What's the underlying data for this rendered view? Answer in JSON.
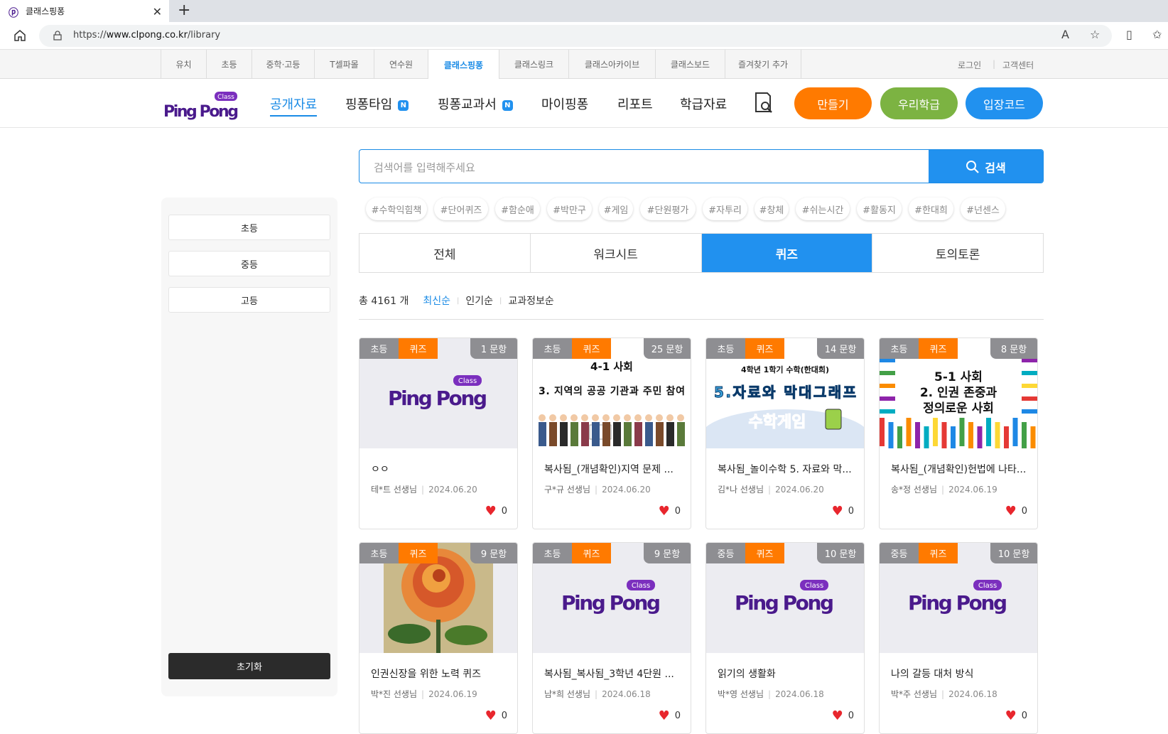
{
  "browser": {
    "tab_title": "클래스핑퐁",
    "url_prefix": "https://",
    "url_host": "www.clpong.co.kr",
    "url_path": "/library"
  },
  "service_nav": {
    "items": [
      "유치",
      "초등",
      "중학·고등",
      "T셀파몰",
      "연수원",
      "클래스핑퐁",
      "클래스링크",
      "클래스아카이브",
      "클래스보드",
      "즐겨찾기 추가"
    ],
    "active": "클래스핑퐁",
    "login": "로그인",
    "support": "고객센터"
  },
  "gnb": {
    "logo_text": "Ping Pong",
    "logo_badge": "Class",
    "menu": [
      "공개자료",
      "핑퐁타임",
      "핑퐁교과서",
      "마이핑퐁",
      "리포트",
      "학급자료"
    ],
    "new_badge": "N",
    "make": "만들기",
    "our_class": "우리학급",
    "entry_code": "입장코드",
    "colors": {
      "make": "#ff7a00",
      "our_class": "#7cb342",
      "entry_code": "#2191ef"
    }
  },
  "sidebar": {
    "levels": [
      "초등",
      "중등",
      "고등"
    ],
    "reset": "초기화"
  },
  "search": {
    "placeholder": "검색어를 입력해주세요",
    "button": "검색"
  },
  "tags": [
    "#수학익힘책",
    "#단어퀴즈",
    "#함순애",
    "#박만구",
    "#게임",
    "#단원평가",
    "#자투리",
    "#창체",
    "#쉬는시간",
    "#활동지",
    "#한대희",
    "#넌센스"
  ],
  "content_tabs": [
    "전체",
    "워크시트",
    "퀴즈",
    "토의토론"
  ],
  "active_tab": "퀴즈",
  "sort": {
    "total_prefix": "총",
    "total_count": "4161",
    "total_suffix": "개",
    "options": [
      "최신순",
      "인기순",
      "교과정보순"
    ]
  },
  "cards": [
    {
      "level": "초등",
      "type": "퀴즈",
      "count": "1 문항",
      "title": "ㅇㅇ",
      "author": "테*트 선생님",
      "date": "2024.06.20",
      "likes": "0",
      "thumb": "logo"
    },
    {
      "level": "초등",
      "type": "퀴즈",
      "count": "25 문항",
      "title": "복사됨_(개념확인)지역 문제 ...",
      "author": "구*규 선생님",
      "date": "2024.06.20",
      "likes": "0",
      "thumb": "social41",
      "thumb_line1": "4-1 사회",
      "thumb_line2": "3. 지역의 공공 기관과 주민 참여"
    },
    {
      "level": "초등",
      "type": "퀴즈",
      "count": "14 문항",
      "title": "복사됨_놀이수학 5. 자료와 막...",
      "author": "김*나 선생님",
      "date": "2024.06.20",
      "likes": "0",
      "thumb": "math",
      "thumb_line1": "4학년 1학기 수학(한대희)",
      "thumb_line2": "5.자료와 막대그래프",
      "thumb_line3": "수학게임"
    },
    {
      "level": "초등",
      "type": "퀴즈",
      "count": "8 문항",
      "title": "복사됨_(개념확인)헌법에 나타...",
      "author": "송*정 선생님",
      "date": "2024.06.19",
      "likes": "0",
      "thumb": "social51",
      "thumb_line1": "5-1 사회",
      "thumb_line2": "2. 인권 존중과",
      "thumb_line3": "정의로운 사회"
    },
    {
      "level": "초등",
      "type": "퀴즈",
      "count": "9 문항",
      "title": "인권신장을 위한 노력 퀴즈",
      "author": "박*진 선생님",
      "date": "2024.06.19",
      "likes": "0",
      "thumb": "rose"
    },
    {
      "level": "초등",
      "type": "퀴즈",
      "count": "9 문항",
      "title": "복사됨_복사됨_3학년 4단원 ...",
      "author": "남*희 선생님",
      "date": "2024.06.18",
      "likes": "0",
      "thumb": "logo"
    },
    {
      "level": "중등",
      "type": "퀴즈",
      "count": "10 문항",
      "title": "읽기의 생활화",
      "author": "박*영 선생님",
      "date": "2024.06.18",
      "likes": "0",
      "thumb": "logo"
    },
    {
      "level": "중등",
      "type": "퀴즈",
      "count": "10 문항",
      "title": "나의 갈등 대처 방식",
      "author": "박*주 선생님",
      "date": "2024.06.18",
      "likes": "0",
      "thumb": "logo"
    }
  ]
}
